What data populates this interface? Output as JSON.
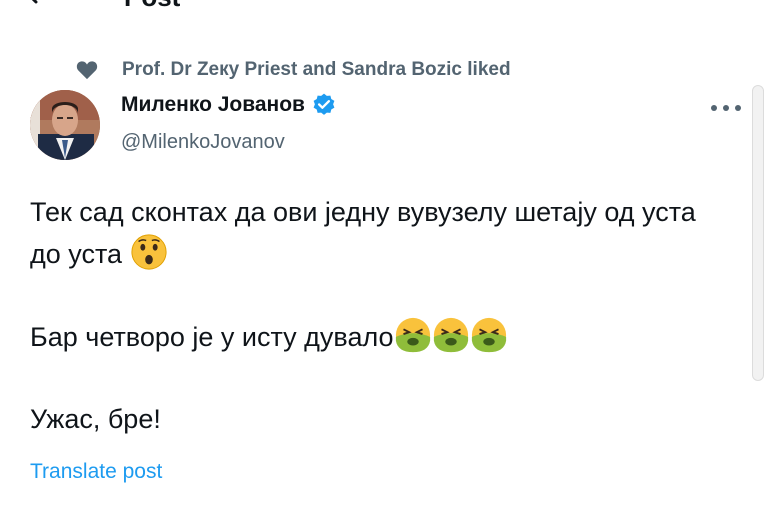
{
  "header": {
    "title": "Post",
    "back_icon": "arrow-left-icon"
  },
  "social_context": {
    "icon": "heart-icon",
    "text": "Prof. Dr Zeку Priest and Sandra Bozic liked"
  },
  "author": {
    "name": "Миленко Јованов",
    "handle": "@MilenkoJovanov",
    "verified": true,
    "verified_color": "#1d9bf0"
  },
  "post": {
    "line1_text": "Тек сад сконтах да ови једну вувузелу шетају од уста до уста",
    "line1_emoji": "astonished-face-emoji",
    "line2_text": "Бар четворо је у исту дувало",
    "line2_emoji": "nauseated-face-emoji",
    "line2_emoji_count": 3,
    "line3_text": "Ужас, бре!"
  },
  "actions": {
    "translate_label": "Translate post",
    "more_icon": "more-horizontal-icon"
  },
  "colors": {
    "link": "#1d9bf0",
    "secondary_text": "#536471",
    "primary_text": "#0f1419"
  }
}
